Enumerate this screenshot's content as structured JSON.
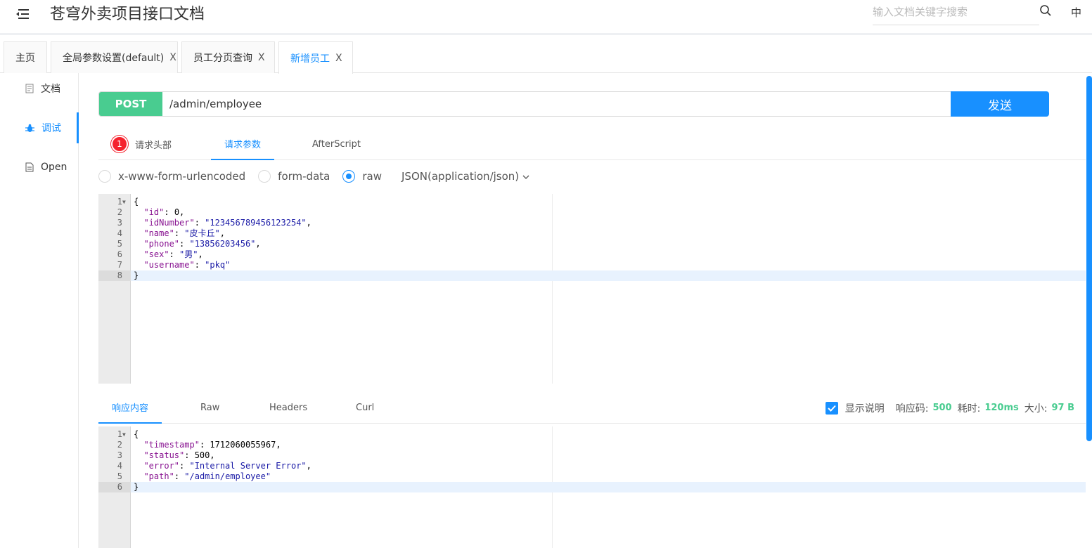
{
  "header": {
    "title": "苍穹外卖项目接口文档",
    "search_placeholder": "输入文档关键字搜索",
    "lang": "中"
  },
  "tabs": [
    {
      "label": "主页",
      "closable": false
    },
    {
      "label": "全局参数设置(default)",
      "closable": true
    },
    {
      "label": "员工分页查询",
      "closable": true
    },
    {
      "label": "新增员工",
      "closable": true,
      "active": true
    }
  ],
  "close_glyph": "X",
  "sidenav": {
    "items": [
      {
        "label": "文档",
        "icon": "document-icon"
      },
      {
        "label": "调试",
        "icon": "bug-icon",
        "active": true
      },
      {
        "label": "Open",
        "icon": "file-icon"
      }
    ]
  },
  "request": {
    "method": "POST",
    "url": "/admin/employee",
    "send_label": "发送",
    "method_color": "#49cc90",
    "accent": "#1890ff"
  },
  "req_tabs": {
    "headers_badge": "1",
    "headers_label": "请求头部",
    "params_label": "请求参数",
    "afterscript_label": "AfterScript"
  },
  "body_types": {
    "urlencoded": "x-www-form-urlencoded",
    "formdata": "form-data",
    "raw": "raw",
    "selected": "raw",
    "content_type": "JSON(application/json)"
  },
  "request_body": [
    "{",
    "  \"id\": 0,",
    "  \"idNumber\": \"123456789456123254\",",
    "  \"name\": \"皮卡丘\",",
    "  \"phone\": \"13856203456\",",
    "  \"sex\": \"男\",",
    "  \"username\": \"pkq\"",
    "}"
  ],
  "response_tabs": {
    "content_label": "响应内容",
    "raw_label": "Raw",
    "headers_label": "Headers",
    "curl_label": "Curl"
  },
  "response_meta": {
    "show_desc_label": "显示说明",
    "show_desc_checked": true,
    "code_label": "响应码:",
    "code": "500",
    "time_label": "耗时:",
    "time": "120ms",
    "size_label": "大小:",
    "size": "97 B"
  },
  "response_body": [
    "{",
    "  \"timestamp\": 1712060055967,",
    "  \"status\": 500,",
    "  \"error\": \"Internal Server Error\",",
    "  \"path\": \"/admin/employee\"",
    "}"
  ]
}
